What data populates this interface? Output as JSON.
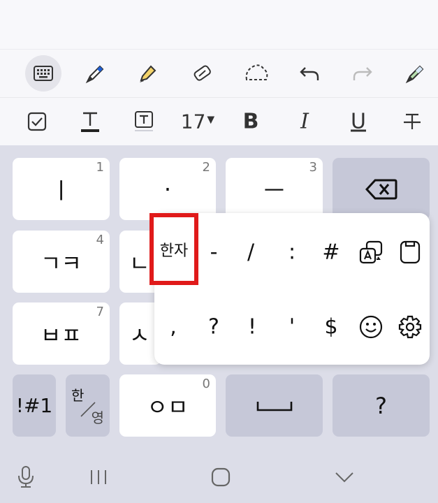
{
  "toolbar": {
    "row1": [
      "keyboard-icon",
      "pen-icon",
      "highlighter-icon",
      "eraser-icon",
      "lasso-icon",
      "undo-icon",
      "redo-icon",
      "pen-settings-icon"
    ],
    "font_size": "17",
    "font_size_caret": "▼",
    "bold": "B",
    "italic": "I",
    "underline": "U"
  },
  "keyboard": {
    "keys": {
      "k1": {
        "label": "ㅣ",
        "num": "1"
      },
      "k2": {
        "label": "·",
        "num": "2"
      },
      "k3": {
        "label": "ㅡ",
        "num": "3"
      },
      "k4": {
        "label": "ㄱㅋ",
        "num": "4"
      },
      "k5": {
        "label": "ㄴ",
        "num": ""
      },
      "k7": {
        "label": "ㅂㅍ",
        "num": "7"
      },
      "k8": {
        "label": "ㅅ",
        "num": ""
      },
      "symbols": "!#1",
      "lang_top": "한",
      "lang_bottom": "영",
      "k0": {
        "label": "ㅇㅁ",
        "num": "0"
      },
      "question": "?"
    }
  },
  "popup": {
    "hanja": "한자",
    "row1": [
      "-",
      "/",
      ":",
      "#"
    ],
    "row2": [
      ",",
      "?",
      "!",
      "'",
      "$"
    ]
  },
  "colors": {
    "highlight_border": "#e01a1a",
    "keyboard_bg": "#dcdde8",
    "function_key": "#c6c8d8",
    "pen_blue": "#1e5fd6",
    "highlighter_yellow": "#f3d36a"
  }
}
